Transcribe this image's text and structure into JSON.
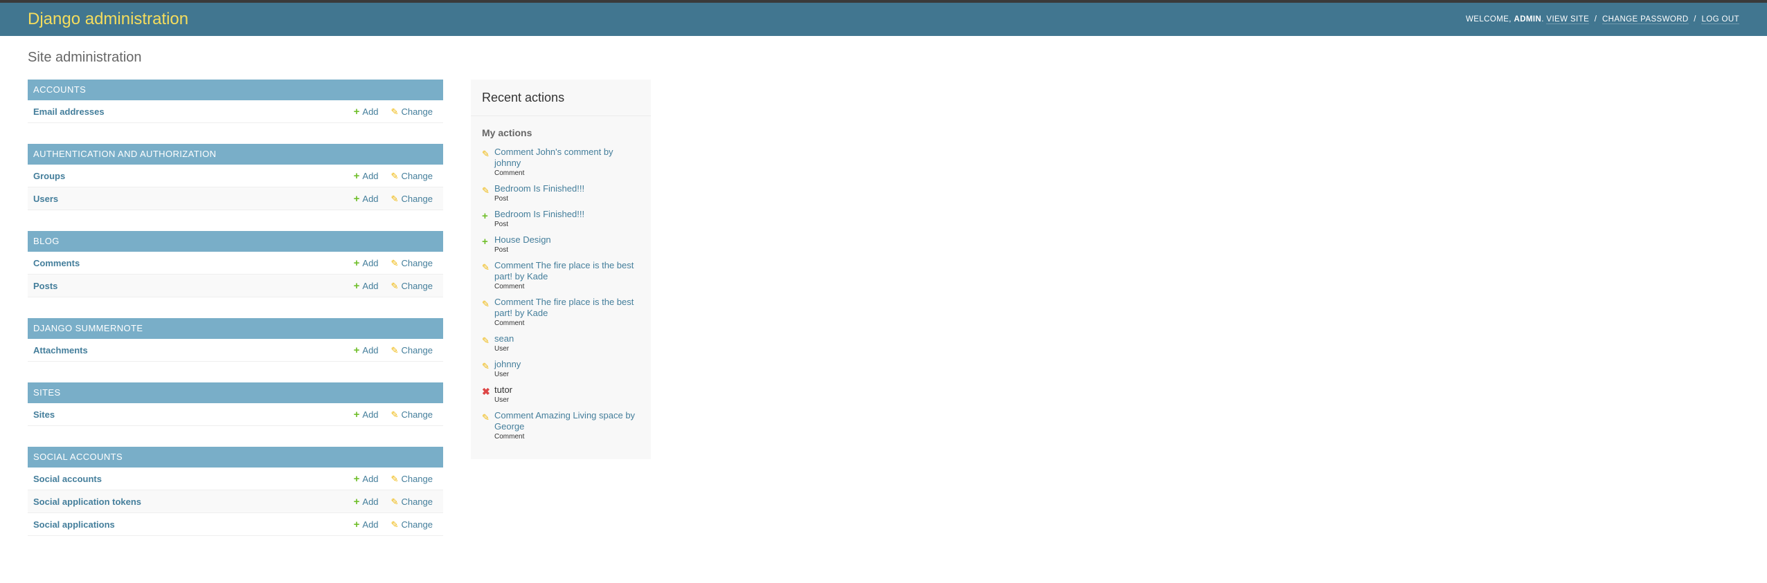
{
  "header": {
    "branding": "Django administration",
    "welcome": "WELCOME,",
    "username": "ADMIN",
    "view_site": "VIEW SITE",
    "change_password": "CHANGE PASSWORD",
    "log_out": "LOG OUT",
    "separator": "/"
  },
  "page_title": "Site administration",
  "common": {
    "add_label": "Add",
    "change_label": "Change"
  },
  "modules": [
    {
      "caption": "Accounts",
      "models": [
        "Email addresses"
      ]
    },
    {
      "caption": "Authentication and Authorization",
      "models": [
        "Groups",
        "Users"
      ]
    },
    {
      "caption": "Blog",
      "models": [
        "Comments",
        "Posts"
      ]
    },
    {
      "caption": "Django Summernote",
      "models": [
        "Attachments"
      ]
    },
    {
      "caption": "Sites",
      "models": [
        "Sites"
      ]
    },
    {
      "caption": "Social Accounts",
      "models": [
        "Social accounts",
        "Social application tokens",
        "Social applications"
      ]
    }
  ],
  "recent_actions": {
    "title": "Recent actions",
    "subtitle": "My actions",
    "items": [
      {
        "kind": "change",
        "title": "Comment John's comment by johnny",
        "type": "Comment"
      },
      {
        "kind": "change",
        "title": "Bedroom Is Finished!!!",
        "type": "Post"
      },
      {
        "kind": "add",
        "title": "Bedroom Is Finished!!!",
        "type": "Post"
      },
      {
        "kind": "add",
        "title": "House Design",
        "type": "Post"
      },
      {
        "kind": "change",
        "title": "Comment The fire place is the best part! by Kade",
        "type": "Comment"
      },
      {
        "kind": "change",
        "title": "Comment The fire place is the best part! by Kade",
        "type": "Comment"
      },
      {
        "kind": "change",
        "title": "sean",
        "type": "User"
      },
      {
        "kind": "change",
        "title": "johnny",
        "type": "User"
      },
      {
        "kind": "delete",
        "title": "tutor",
        "type": "User"
      },
      {
        "kind": "change",
        "title": "Comment Amazing Living space by George",
        "type": "Comment"
      }
    ]
  },
  "colors": {
    "header_bg": "#417690",
    "branding": "#f5dd5d",
    "module_header_bg": "#79aec8",
    "link": "#447e9b",
    "add_icon": "#70bf2b",
    "change_icon": "#efb80b",
    "delete_icon": "#dd4646"
  },
  "icons": {
    "add": "plus-icon",
    "change": "pencil-icon",
    "delete": "delete-icon"
  }
}
